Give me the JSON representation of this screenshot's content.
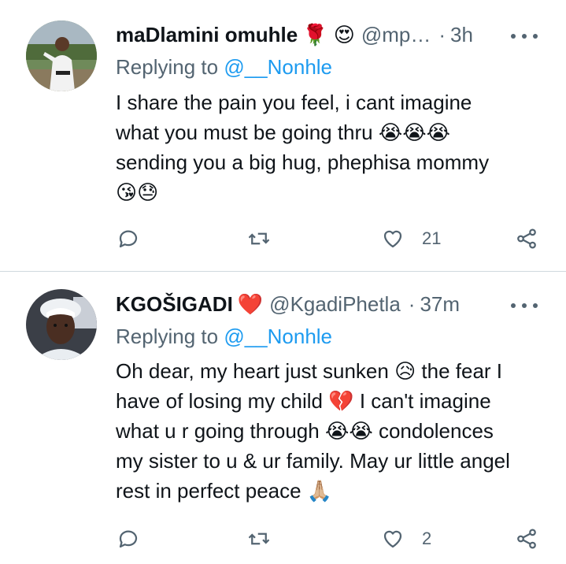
{
  "tweets": [
    {
      "display_name": "maDlamini omuhle",
      "name_emojis": "🌹 😍",
      "handle": "@mp…",
      "separator": "·",
      "time": "3h",
      "reply_prefix": "Replying to",
      "reply_to": "@__Nonhle",
      "body": "I share the pain you feel, i cant imagine\nwhat you must be going thru 😭😭😭\nsending you a big hug, phephisa mommy\n😘😓",
      "like_count": "21",
      "avatar_icon": "user-photo-icon"
    },
    {
      "display_name": "KGOŠIGADI",
      "name_emojis": "❤️",
      "handle": "@KgadiPhetla",
      "separator": "·",
      "time": "37m",
      "reply_prefix": "Replying to",
      "reply_to": "@__Nonhle",
      "body": "Oh dear, my heart just sunken 😥 the fear I\nhave of losing my child 💔 I can't imagine\nwhat u r going through 😭😭 condolences\nmy sister to u & ur family. May ur little angel\nrest in perfect peace 🙏🏼",
      "like_count": "2",
      "avatar_icon": "user-photo-icon"
    }
  ],
  "colors": {
    "text": "#0f1419",
    "secondary": "#536471",
    "link": "#1d9bf0",
    "divider": "#cfd9de"
  }
}
